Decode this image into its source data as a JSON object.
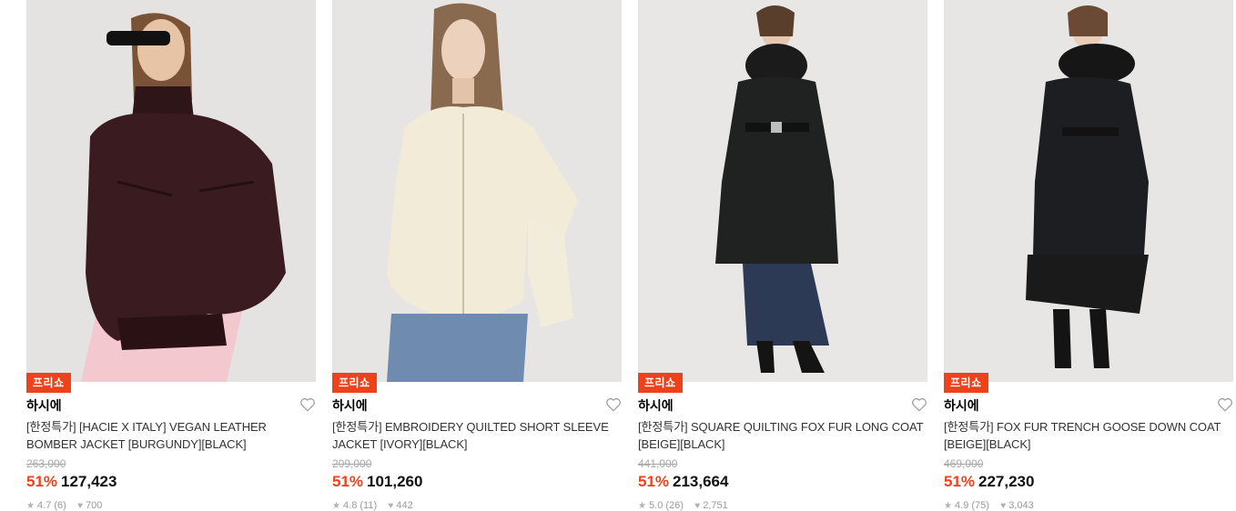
{
  "products": [
    {
      "badge": "프리쇼",
      "brand": "하시에",
      "title": "[한정특가] [HACIE X ITALY] VEGAN LEATHER BOMBER JACKET [BURGUNDY][BLACK]",
      "original_price": "263,000",
      "discount": "51%",
      "price": "127,423",
      "rating": "4.7 (6)",
      "likes": "700",
      "image": "model-burgundy-leather-bomber"
    },
    {
      "badge": "프리쇼",
      "brand": "하시에",
      "title": "[한정특가] EMBROIDERY QUILTED SHORT SLEEVE JACKET [IVORY][BLACK]",
      "original_price": "209,000",
      "discount": "51%",
      "price": "101,260",
      "rating": "4.8 (11)",
      "likes": "442",
      "image": "model-ivory-quilted-jacket"
    },
    {
      "badge": "프리쇼",
      "brand": "하시에",
      "title": "[한정특가] SQUARE QUILTING FOX FUR LONG COAT [BEIGE][BLACK]",
      "original_price": "441,000",
      "discount": "51%",
      "price": "213,664",
      "rating": "5.0 (26)",
      "likes": "2,751",
      "image": "model-black-long-puffer-coat"
    },
    {
      "badge": "프리쇼",
      "brand": "하시에",
      "title": "[한정특가] FOX FUR TRENCH GOOSE DOWN COAT [BEIGE][BLACK]",
      "original_price": "469,000",
      "discount": "51%",
      "price": "227,230",
      "rating": "4.9 (75)",
      "likes": "3,043",
      "image": "model-black-trench-down-coat"
    }
  ],
  "colors": {
    "accent": "#f0421a",
    "muted": "#a8a8a8"
  }
}
